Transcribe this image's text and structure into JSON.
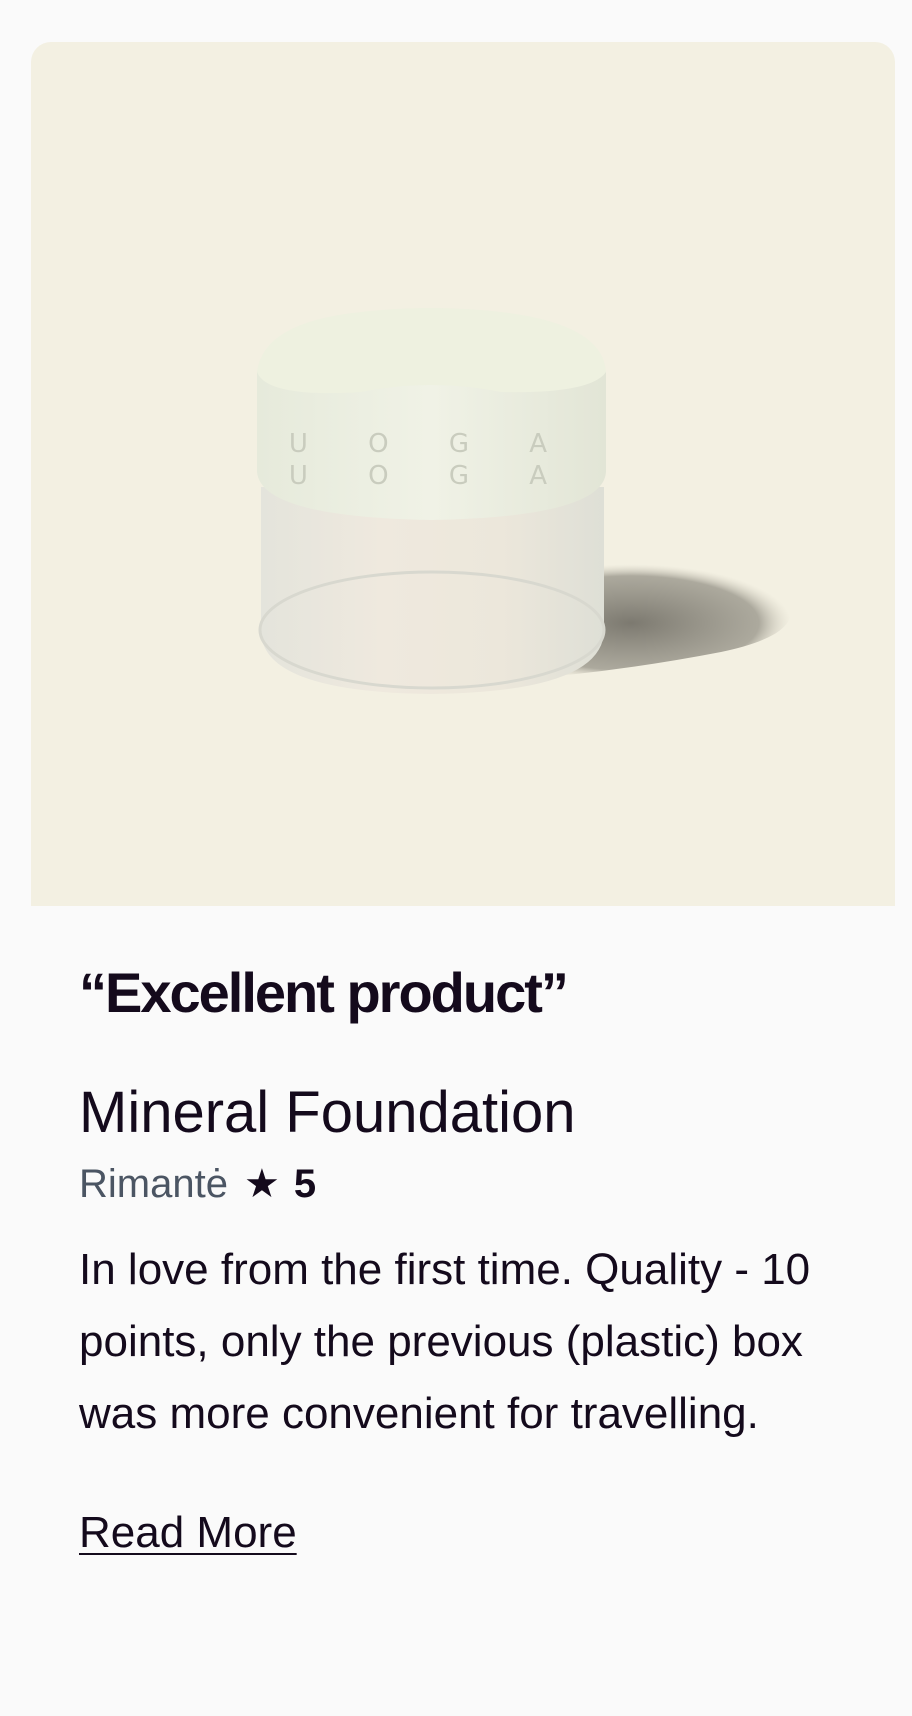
{
  "review": {
    "headline": "“Excellent product”",
    "product_name": "Mineral Foundation",
    "author": "Rimantė",
    "rating": "5",
    "star_icon": "star-icon",
    "text": "In love from the first time. Quality - 10 points, only the previous (plastic) box was more convenient for travelling.",
    "read_more_label": "Read More"
  },
  "product_image": {
    "brand_mark": "U O G A",
    "background_color": "#f3f0e2"
  },
  "colors": {
    "text": "#140a1c",
    "muted": "#4b5563",
    "page_bg": "#fafafa"
  }
}
